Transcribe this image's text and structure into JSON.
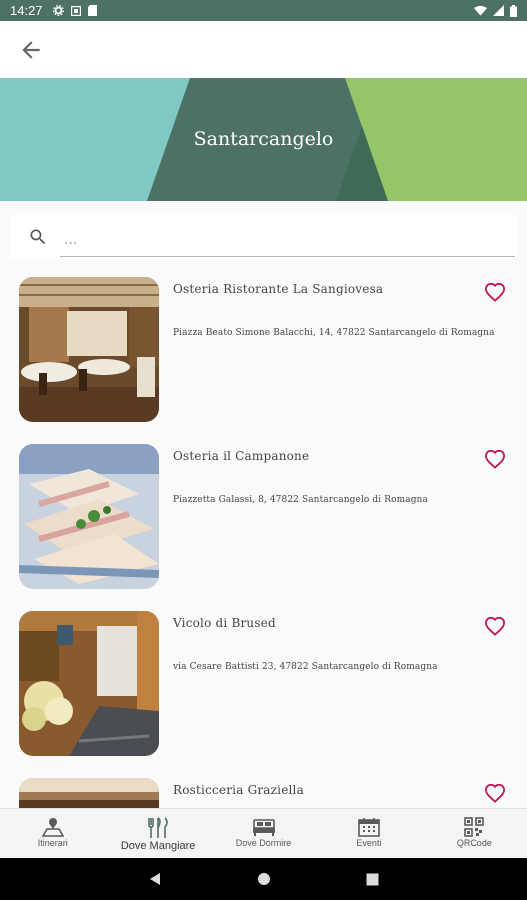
{
  "status_bar": {
    "time": "14:27"
  },
  "header": {
    "title": "Santarcangelo"
  },
  "search": {
    "placeholder": "..."
  },
  "colors": {
    "teal_light": "#7fc8c4",
    "teal_dark": "#4e7166",
    "green": "#95c567",
    "heart": "#c2185b"
  },
  "restaurants": [
    {
      "name": "Osteria Ristorante La Sangiovesa",
      "address": "Piazza Beato Simone Balacchi, 14, 47822 Santarcangelo di Romagna"
    },
    {
      "name": "Osteria il Campanone",
      "address": "Piazzetta Galassi, 8, 47822 Santarcangelo di Romagna"
    },
    {
      "name": "Vicolo di Brused",
      "address": "via Cesare Battisti 23, 47822 Santarcangelo di Romagna"
    },
    {
      "name": "Rosticceria Graziella",
      "address": ""
    }
  ],
  "bottom_nav": [
    {
      "label": "Itinerari",
      "icon": "map-icon"
    },
    {
      "label": "Dove Mangiare",
      "icon": "cutlery-icon"
    },
    {
      "label": "Dove Dormire",
      "icon": "bed-icon"
    },
    {
      "label": "Eventi",
      "icon": "calendar-icon"
    },
    {
      "label": "QRCode",
      "icon": "qrcode-icon"
    }
  ]
}
